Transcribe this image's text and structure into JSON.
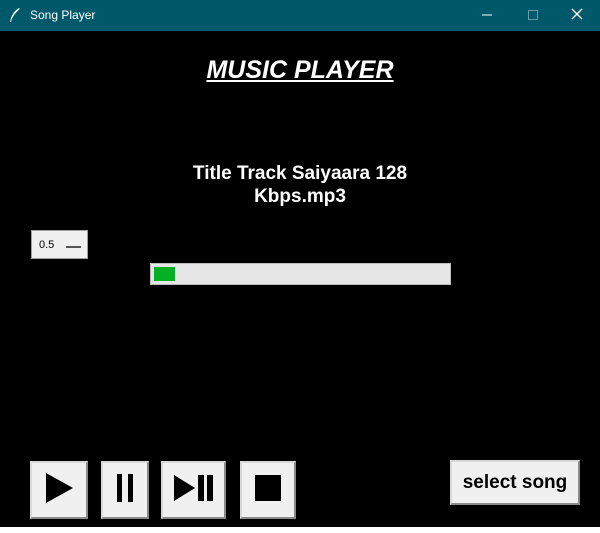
{
  "window": {
    "title": "Song Player",
    "icon": "feather-icon",
    "controls": [
      "minimize-icon",
      "maximize-icon",
      "close-icon"
    ]
  },
  "heading": "MUSIC PLAYER",
  "song": {
    "title": "Title Track Saiyaara 128 Kbps.mp3"
  },
  "volume": {
    "value": "0.5"
  },
  "progress": {
    "fraction": 0.03,
    "color": "#06b025"
  },
  "controls": {
    "play_icon": "play-icon",
    "pause_icon": "pause-icon",
    "next_icon": "play-pause-icon",
    "stop_icon": "stop-icon"
  },
  "select_button": {
    "label": "select song"
  },
  "colors": {
    "titlebar": "#00586b",
    "background": "#000000",
    "button": "#f0f0f0"
  }
}
